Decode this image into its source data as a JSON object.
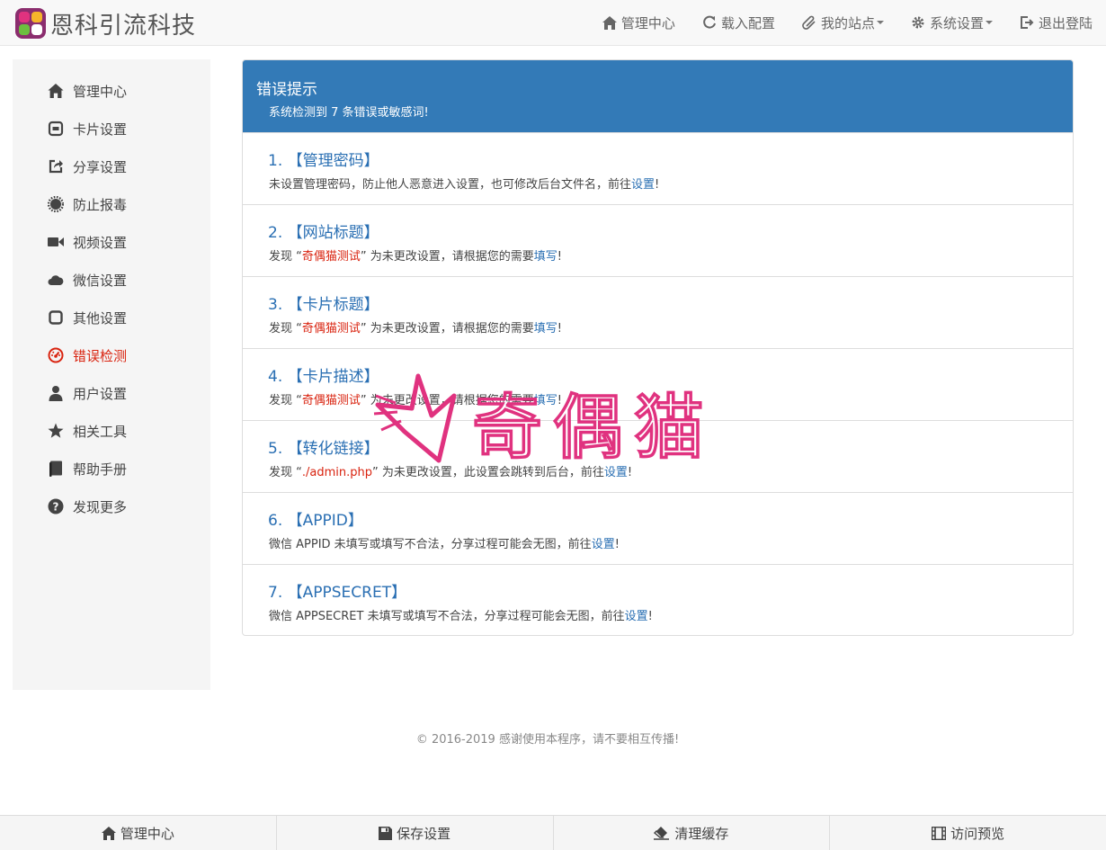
{
  "brand": {
    "name": "恩科引流科技"
  },
  "topnav": {
    "items": [
      {
        "label": "管理中心",
        "icon": "home-icon"
      },
      {
        "label": "载入配置",
        "icon": "refresh-icon"
      },
      {
        "label": "我的站点",
        "icon": "paperclip-icon",
        "dropdown": true
      },
      {
        "label": "系统设置",
        "icon": "gear-icon",
        "dropdown": true
      },
      {
        "label": "退出登陆",
        "icon": "logout-icon"
      }
    ]
  },
  "sidebar": {
    "items": [
      {
        "label": "管理中心",
        "icon": "home-icon"
      },
      {
        "label": "卡片设置",
        "icon": "card-icon"
      },
      {
        "label": "分享设置",
        "icon": "share-icon"
      },
      {
        "label": "防止报毒",
        "icon": "certificate-icon"
      },
      {
        "label": "视频设置",
        "icon": "video-icon"
      },
      {
        "label": "微信设置",
        "icon": "cloud-icon"
      },
      {
        "label": "其他设置",
        "icon": "square-icon"
      },
      {
        "label": "错误检测",
        "icon": "dashboard-icon",
        "active": true
      },
      {
        "label": "用户设置",
        "icon": "user-icon"
      },
      {
        "label": "相关工具",
        "icon": "star-icon"
      },
      {
        "label": "帮助手册",
        "icon": "book-icon"
      },
      {
        "label": "发现更多",
        "icon": "question-icon"
      }
    ]
  },
  "panel": {
    "title": "错误提示",
    "subtitle": "系统检测到 7 条错误或敏感词!",
    "errors": [
      {
        "title": "1. 【管理密码】",
        "pre": "未设置管理密码，防止他人恶意进入设置，也可修改后台文件名，前往",
        "red": "",
        "mid": "",
        "link": "设置",
        "post": "!"
      },
      {
        "title": "2. 【网站标题】",
        "pre": "发现 “",
        "red": "奇偶猫测试",
        "mid": "” 为未更改设置，请根据您的需要",
        "link": "填写",
        "post": "!"
      },
      {
        "title": "3. 【卡片标题】",
        "pre": "发现 “",
        "red": "奇偶猫测试",
        "mid": "” 为未更改设置，请根据您的需要",
        "link": "填写",
        "post": "!"
      },
      {
        "title": "4. 【卡片描述】",
        "pre": "发现 “",
        "red": "奇偶猫测试",
        "mid": "” 为未更改设置，请根据您的需要",
        "link": "填写",
        "post": "!"
      },
      {
        "title": "5. 【转化链接】",
        "pre": "发现 “",
        "red": "./admin.php",
        "mid": "” 为未更改设置，此设置会跳转到后台，前往",
        "link": "设置",
        "post": "!"
      },
      {
        "title": "6. 【APPID】",
        "pre": "微信 APPID 未填写或填写不合法，分享过程可能会无图，前往",
        "red": "",
        "mid": "",
        "link": "设置",
        "post": "!"
      },
      {
        "title": "7. 【APPSECRET】",
        "pre": "微信 APPSECRET 未填写或填写不合法，分享过程可能会无图，前往",
        "red": "",
        "mid": "",
        "link": "设置",
        "post": "!"
      }
    ]
  },
  "footer": {
    "copyright": "© 2016-2019    感谢使用本程序，请不要相互传播!"
  },
  "bottombar": {
    "items": [
      {
        "label": "管理中心",
        "icon": "home-icon"
      },
      {
        "label": "保存设置",
        "icon": "floppy-icon"
      },
      {
        "label": "清理缓存",
        "icon": "eraser-icon"
      },
      {
        "label": "访问预览",
        "icon": "film-icon"
      }
    ]
  },
  "watermark": {
    "text": "奇偶猫"
  },
  "colors": {
    "primary": "#337ab7",
    "danger": "#d9230f",
    "watermark": "#e0327f"
  }
}
